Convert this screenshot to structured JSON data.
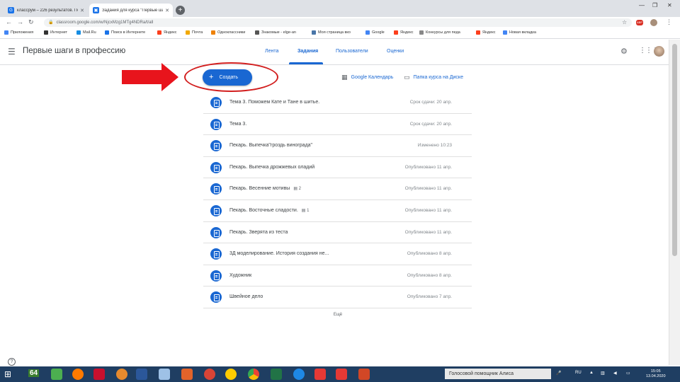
{
  "browser": {
    "tabs": [
      {
        "title": "классрум – 226 результатов. По",
        "active": false
      },
      {
        "title": "Задания для курса \"Первые ша",
        "active": true
      }
    ],
    "new_tab": "+",
    "window_controls": {
      "minimize": "—",
      "maximize": "❐",
      "close": "✕"
    },
    "url": "classroom.google.com/w/NjcxMzg1MTg4NDRa/t/all",
    "bookmarks": [
      {
        "label": "Приложения",
        "color": "#4285f4"
      },
      {
        "label": "Интернет",
        "color": "#333333"
      },
      {
        "label": "Mail.Ru",
        "color": "#168de2"
      },
      {
        "label": "Поиск в Интернете",
        "color": "#1a73e8"
      },
      {
        "label": "Яндекс",
        "color": "#fc3f1d"
      },
      {
        "label": "Почта",
        "color": "#f2a900"
      },
      {
        "label": "Одноклассники",
        "color": "#ee8208"
      },
      {
        "label": "Знакомые - elge-an",
        "color": "#555555"
      },
      {
        "label": "Моя страница вко",
        "color": "#4a76a8"
      },
      {
        "label": "Google",
        "color": "#4285f4"
      },
      {
        "label": "Яндекс",
        "color": "#fc3f1d"
      },
      {
        "label": "Конкурсы для педа",
        "color": "#888888"
      },
      {
        "label": "Яндекс",
        "color": "#fc3f1d"
      },
      {
        "label": "Новая вкладка",
        "color": "#4285f4"
      }
    ]
  },
  "classroom": {
    "course_title": "Первые шаги в профессию",
    "nav": [
      "Лента",
      "Задания",
      "Пользователи",
      "Оценки"
    ],
    "active_nav": "Задания",
    "create_label": "Создать",
    "calendar_label": "Google Календарь",
    "drive_label": "Папка курса на Диске",
    "assignments": [
      {
        "title": "Тема 3. Поможем Кате и Тане в шитье.",
        "comments": "",
        "status": "Срок сдачи: 20 апр."
      },
      {
        "title": "Тема 3.",
        "comments": "",
        "status": "Срок сдачи: 20 апр."
      },
      {
        "title": "Пекарь. Выпечка\"гроздь винограда\"",
        "comments": "",
        "status": "Изменено 10:23"
      },
      {
        "title": "Пекарь. Выпечка дрожжевых оладий",
        "comments": "",
        "status": "Опубликовано 11 апр."
      },
      {
        "title": "Пекарь. Весенние мотивы",
        "comments": "2",
        "status": "Опубликовано 11 апр."
      },
      {
        "title": "Пекарь. Восточные сладости.",
        "comments": "1",
        "status": "Опубликовано 11 апр."
      },
      {
        "title": "Пекарь. Зверята из теста",
        "comments": "",
        "status": "Опубликовано 11 апр."
      },
      {
        "title": "3Д моделирование. История создания не...",
        "comments": "",
        "status": "Опубликовано 8 апр."
      },
      {
        "title": "Художник",
        "comments": "",
        "status": "Опубликовано 8 апр."
      },
      {
        "title": "Швейное дело",
        "comments": "",
        "status": "Опубликовано 7 апр."
      }
    ],
    "more_label": "Ещё",
    "help": "?"
  },
  "taskbar": {
    "counter": "64",
    "voice_assistant": "Голосовой помощник Алиса",
    "lang": "RU",
    "time": "15:05",
    "date": "13.04.2020"
  },
  "colors": {
    "accent": "#1967d2",
    "annotation": "#d21e1e",
    "taskbar": "#1f3e62"
  }
}
